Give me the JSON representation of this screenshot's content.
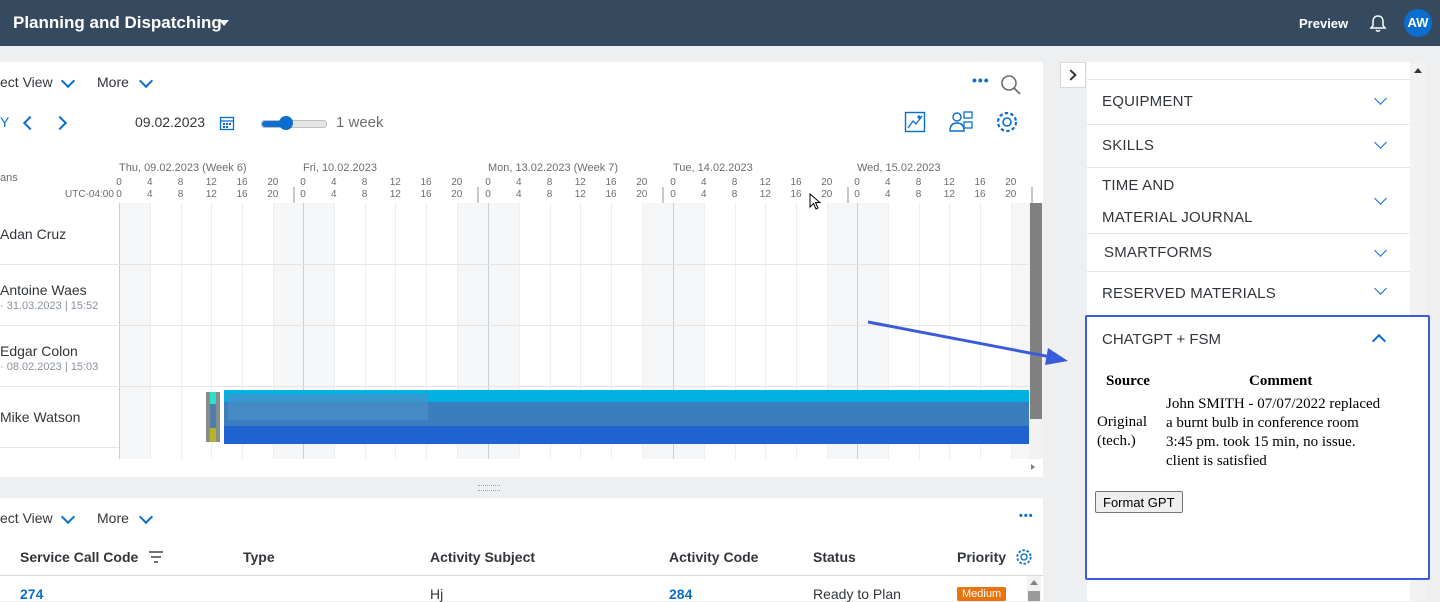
{
  "shell": {
    "title": "Planning and Dispatching",
    "preview": "Preview",
    "avatar": "AW"
  },
  "colors": {
    "shell": "#354a5f",
    "accent": "#0a6ed1",
    "highlight": "#3a5bdc",
    "medium_badge": "#e9730c"
  },
  "planner": {
    "select_view": "ect View",
    "more": "More",
    "today_btn": "Y",
    "date": "09.02.2023",
    "range": "1 week",
    "zoom_level": 0.38,
    "column_label": "ans",
    "timezone": "UTC-04:00",
    "days": [
      "Thu, 09.02.2023 (Week 6)",
      "Fri, 10.02.2023",
      "Mon, 13.02.2023 (Week 7)",
      "Tue, 14.02.2023",
      "Wed, 15.02.2023"
    ],
    "hour_ticks": [
      "0",
      "4",
      "8",
      "12",
      "16",
      "20"
    ],
    "technicians": [
      {
        "name": "Adan Cruz",
        "sub": ""
      },
      {
        "name": "Antoine Waes",
        "sub": "31.03.2023 | 15:52"
      },
      {
        "name": "Edgar Colon",
        "sub": "08.02.2023 | 15:03"
      },
      {
        "name": "Mike Watson",
        "sub": ""
      }
    ]
  },
  "activities": {
    "select_view": "ect View",
    "more": "More",
    "columns": [
      "Service Call Code",
      "Type",
      "Activity Subject",
      "Activity Code",
      "Status",
      "Priority"
    ],
    "rows": [
      {
        "service_call_code": "274",
        "type": "",
        "subject": "Hj",
        "activity_code": "284",
        "status": "Ready to Plan",
        "priority": "Medium"
      }
    ]
  },
  "sidebar": {
    "sections": [
      "EQUIPMENT",
      "SKILLS",
      "TIME AND",
      "MATERIAL JOURNAL",
      "SMARTFORMS",
      "RESERVED MATERIALS"
    ],
    "chatgpt": {
      "title": "CHATGPT + FSM",
      "col_source": "Source",
      "col_comment": "Comment",
      "source_line1": "Original",
      "source_line2": "(tech.)",
      "comment_lines": [
        "John SMITH - 07/07/2022 replaced",
        "a burnt bulb in conference room",
        "3:45 pm. took 15 min, no issue.",
        "client is satisfied"
      ],
      "button": "Format GPT"
    }
  }
}
